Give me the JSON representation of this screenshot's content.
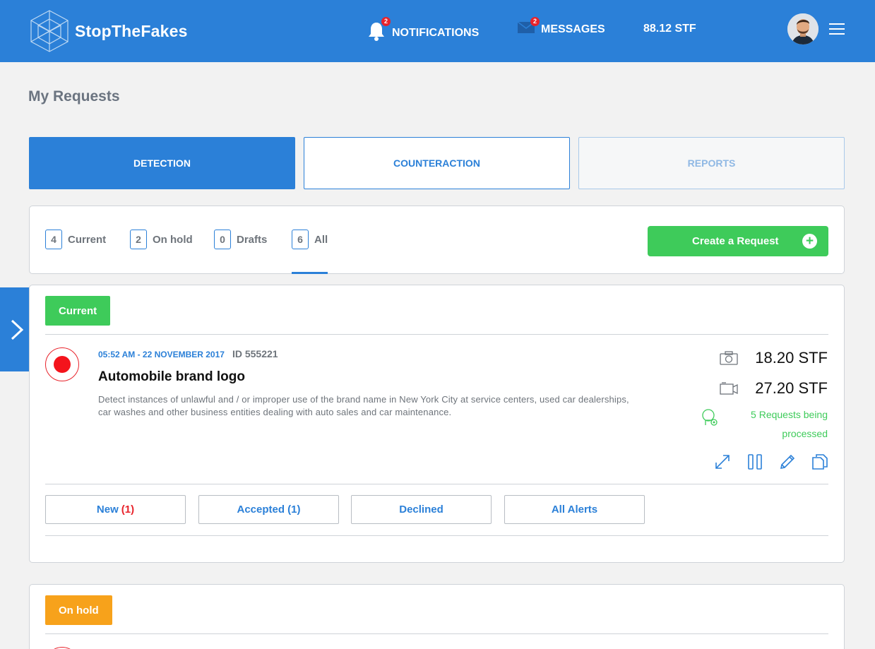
{
  "header": {
    "brand": "StopTheFakes",
    "notifications": {
      "label": "NOTIFICATIONS",
      "count": "2",
      "icon": "bell-icon"
    },
    "messages": {
      "label": "MESSAGES",
      "count": "2",
      "icon": "envelope-icon"
    },
    "balance": "88.12 STF"
  },
  "page": {
    "title": "My Requests"
  },
  "tabs": [
    {
      "label": "DETECTION",
      "state": "active"
    },
    {
      "label": "COUNTERACTION",
      "state": "default"
    },
    {
      "label": "REPORTS",
      "state": "disabled"
    }
  ],
  "filters": [
    {
      "count": "4",
      "label": "Current"
    },
    {
      "count": "2",
      "label": "On hold"
    },
    {
      "count": "0",
      "label": "Drafts"
    },
    {
      "count": "6",
      "label": "All",
      "selected": true
    }
  ],
  "create_button": {
    "label": "Create a Request"
  },
  "sections": {
    "current": {
      "label": "Current",
      "request": {
        "datetime": "05:52 AM - 22 NOVEMBER 2017",
        "id": "ID 555221",
        "title": "Automobile brand logo",
        "description": "Detect instances of unlawful and / or improper use of the brand name in New York City at service centers, used car dealerships, car washes and other business entities dealing with auto sales and car maintenance.",
        "photo_price": "18.20 STF",
        "video_price": "27.20 STF",
        "processing_line1": "5 Requests being",
        "processing_line2": "processed"
      },
      "alert_buttons": {
        "new_label": "New",
        "new_count": "(1)",
        "accepted": "Accepted (1)",
        "declined": "Declined",
        "all": "All Alerts"
      }
    },
    "on_hold": {
      "label": "On hold"
    }
  },
  "colors": {
    "primary": "#2b80d8",
    "success": "#3ecb5a",
    "warning": "#f7a21b",
    "danger": "#e8232b"
  }
}
